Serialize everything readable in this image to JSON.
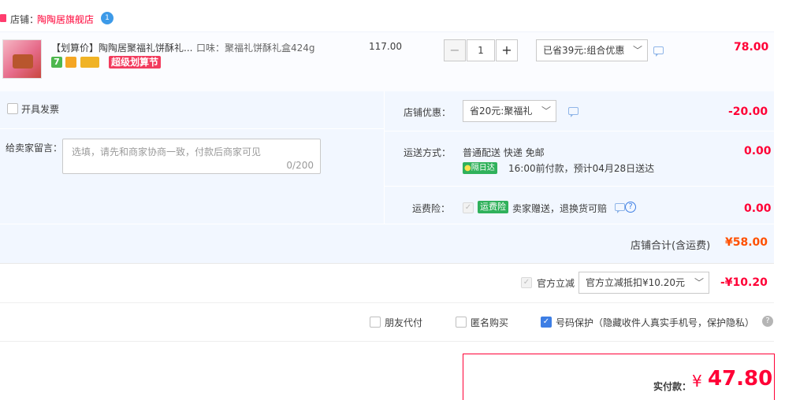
{
  "shop": {
    "prefix": "店铺：",
    "name": "陶陶居旗舰店",
    "badge": "1"
  },
  "item": {
    "title": "【划算价】陶陶居聚福礼饼酥礼...",
    "sku": "口味：聚福礼饼酥礼盒424g",
    "unit_price": "117.00",
    "quantity": "1",
    "discount_select": "已省39元:组合优惠",
    "subtotal": "78.00",
    "badges": [
      "7",
      "超级划算节"
    ]
  },
  "extras": {
    "invoice_label": "开具发票",
    "message_label": "给卖家留言：",
    "message_placeholder": "选填，请先和商家协商一致，付款后商家可见",
    "message_count": "0/200"
  },
  "shop_discount": {
    "label": "店铺优惠：",
    "select": "省20元:聚福礼",
    "amount": "-20.00"
  },
  "shipping": {
    "label": "运送方式：",
    "method": "普通配送 快递 免邮",
    "badge": "隔日达",
    "note": "16:00前付款，预计04月28日送达",
    "amount": "0.00"
  },
  "insurance": {
    "label": "运费险：",
    "badge": "运费险",
    "text": "卖家赠送，退换货可赔",
    "amount": "0.00"
  },
  "shop_total": {
    "label": "店铺合计(含运费)",
    "amount": "¥58.00"
  },
  "official": {
    "label": "官方立减",
    "select": "官方立减抵扣¥10.20元",
    "amount": "-¥10.20"
  },
  "options": {
    "friend_pay": "朋友代付",
    "anonymous": "匿名购买",
    "phone_protect": "号码保护（隐藏收件人真实手机号，保护隐私）"
  },
  "payment": {
    "label": "实付款：",
    "currency": "¥",
    "amount": "47.80"
  },
  "colors": {
    "accent_red": "#ff0036",
    "blue": "#3d7ee4",
    "light_bg": "#f2f7ff"
  }
}
